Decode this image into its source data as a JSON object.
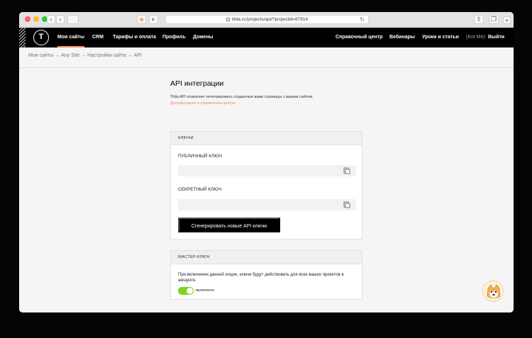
{
  "browser": {
    "url": "tilda.cc/projects/api/?projectid=87914",
    "nav_buttons": [
      "‹",
      "›"
    ]
  },
  "navbar": {
    "logo": "T",
    "items": [
      "Мои сайты",
      "CRM",
      "Тарифы и оплата",
      "Профиль",
      "Домены"
    ],
    "right_items": [
      "Справочный центр",
      "Вебинары",
      "Уроки и статьи"
    ],
    "user": "(Kot Me)",
    "logout": "Выйти"
  },
  "breadcrumbs": [
    "Мои сайты",
    "→",
    "Any Site",
    "→",
    "Настройки сайта",
    "→",
    "API"
  ],
  "page": {
    "title": "API интеграции",
    "description": "Tilda API позволяет интегрировать созданные вами страницы с вашим сайтом.",
    "doc_link": "Документация в справочном центре"
  },
  "keys_panel": {
    "header": "КЛЮЧИ",
    "public_label": "ПУБЛИЧНЫЙ КЛЮЧ",
    "public_value": "",
    "secret_label": "СЕКРЕТНЫЙ КЛЮЧ",
    "secret_value": "",
    "generate_button": "Сгенерировать новые API ключи"
  },
  "master_panel": {
    "header": "МАСТЕР-КЛЮЧ",
    "text": "При включении данной опции, ключи будут действовать для всех ваших проектов в аккаунте.",
    "toggle_label": "включено",
    "toggle_state": "on"
  },
  "colors": {
    "accent": "#ff8562",
    "toggle": "#7ed321"
  }
}
